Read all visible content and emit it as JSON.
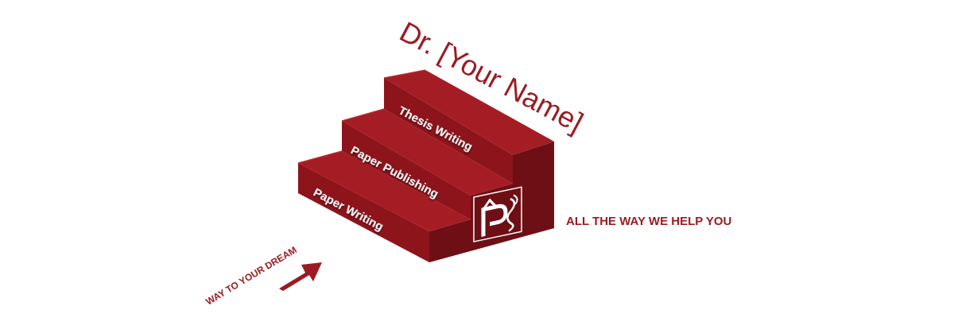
{
  "banner": {
    "title": "Dr. [Your Name]",
    "steps": [
      {
        "label": "Paper Writing"
      },
      {
        "label": "Paper Publishing"
      },
      {
        "label": "Thesis Writing"
      }
    ],
    "tagline": "ALL THE WAY WE HELP YOU",
    "arrow_caption": "WAY TO YOUR DREAM",
    "logo_icon": "ps-logo-icon",
    "arrow_icon": "arrow-icon"
  },
  "colors": {
    "brand_red": "#9b1b22",
    "step_top": "#a51d24",
    "step_riser": "#8e141b",
    "step_side": "#6e0f15",
    "background": "#ffffff"
  }
}
